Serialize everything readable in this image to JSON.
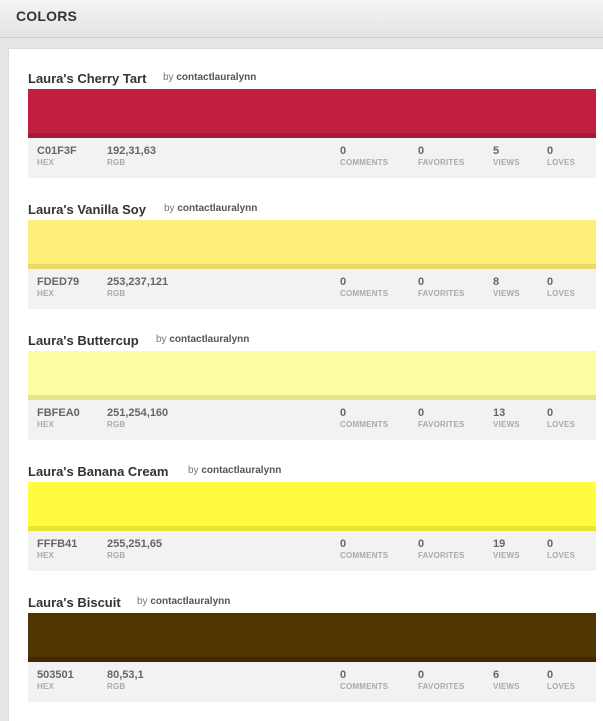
{
  "header": {
    "title": "COLORS"
  },
  "labels": {
    "by": "by",
    "hex": "HEX",
    "rgb": "RGB",
    "comments": "COMMENTS",
    "favorites": "FAVORITES",
    "views": "VIEWS",
    "loves": "LOVES"
  },
  "colors": [
    {
      "name": "Laura's Cherry Tart",
      "author": "contactlauralynn",
      "hex": "C01F3F",
      "rgb": "192,31,63",
      "comments": "0",
      "favorites": "0",
      "views": "5",
      "loves": "0",
      "swatch": "#c01f3f",
      "edge": "#a51a36"
    },
    {
      "name": "Laura's Vanilla Soy",
      "author": "contactlauralynn",
      "hex": "FDED79",
      "rgb": "253,237,121",
      "comments": "0",
      "favorites": "0",
      "views": "8",
      "loves": "0",
      "swatch": "#fded79",
      "edge": "#e8d865"
    },
    {
      "name": "Laura's Buttercup",
      "author": "contactlauralynn",
      "hex": "FBFEA0",
      "rgb": "251,254,160",
      "comments": "0",
      "favorites": "0",
      "views": "13",
      "loves": "0",
      "swatch": "#fbfea0",
      "edge": "#e4e88a"
    },
    {
      "name": "Laura's Banana Cream",
      "author": "contactlauralynn",
      "hex": "FFFB41",
      "rgb": "255,251,65",
      "comments": "0",
      "favorites": "0",
      "views": "19",
      "loves": "0",
      "swatch": "#fffb41",
      "edge": "#e8e430"
    },
    {
      "name": "Laura's Biscuit",
      "author": "contactlauralynn",
      "hex": "503501",
      "rgb": "80,53,1",
      "comments": "0",
      "favorites": "0",
      "views": "6",
      "loves": "0",
      "swatch": "#503501",
      "edge": "#3f2a01"
    }
  ]
}
